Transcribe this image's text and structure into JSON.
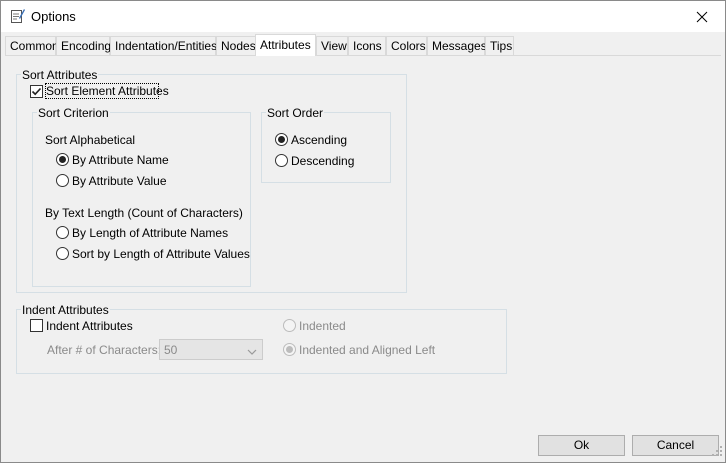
{
  "window": {
    "title": "Options"
  },
  "tabs": [
    {
      "label": "Common"
    },
    {
      "label": "Encoding"
    },
    {
      "label": "Indentation/Entities"
    },
    {
      "label": "Nodes"
    },
    {
      "label": "Attributes"
    },
    {
      "label": "View"
    },
    {
      "label": "Icons"
    },
    {
      "label": "Colors"
    },
    {
      "label": "Messages"
    },
    {
      "label": "Tips"
    }
  ],
  "active_tab": "Attributes",
  "sort_attributes": {
    "legend": "Sort Attributes",
    "sort_element_checkbox": {
      "label": "Sort Element Attributes",
      "checked": true
    },
    "criterion": {
      "legend": "Sort Criterion",
      "alphabetical_label": "Sort Alphabetical",
      "by_name": {
        "label": "By Attribute Name",
        "selected": true
      },
      "by_value": {
        "label": "By Attribute Value",
        "selected": false
      },
      "text_length_label": "By Text Length (Count of Characters)",
      "by_length_names": {
        "label": "By Length of Attribute Names",
        "selected": false
      },
      "by_length_values": {
        "label": "Sort by Length of Attribute Values",
        "selected": false
      }
    },
    "order": {
      "legend": "Sort Order",
      "ascending": {
        "label": "Ascending",
        "selected": true
      },
      "descending": {
        "label": "Descending",
        "selected": false
      }
    }
  },
  "indent_attributes": {
    "legend": "Indent Attributes",
    "indent_checkbox": {
      "label": "Indent Attributes",
      "checked": false
    },
    "after_chars_label": "After # of Characters:",
    "after_chars_value": "50",
    "indented": {
      "label": "Indented",
      "selected": false
    },
    "indented_aligned_left": {
      "label": "Indented and Aligned Left",
      "selected": true
    }
  },
  "buttons": {
    "ok": "Ok",
    "cancel": "Cancel"
  }
}
